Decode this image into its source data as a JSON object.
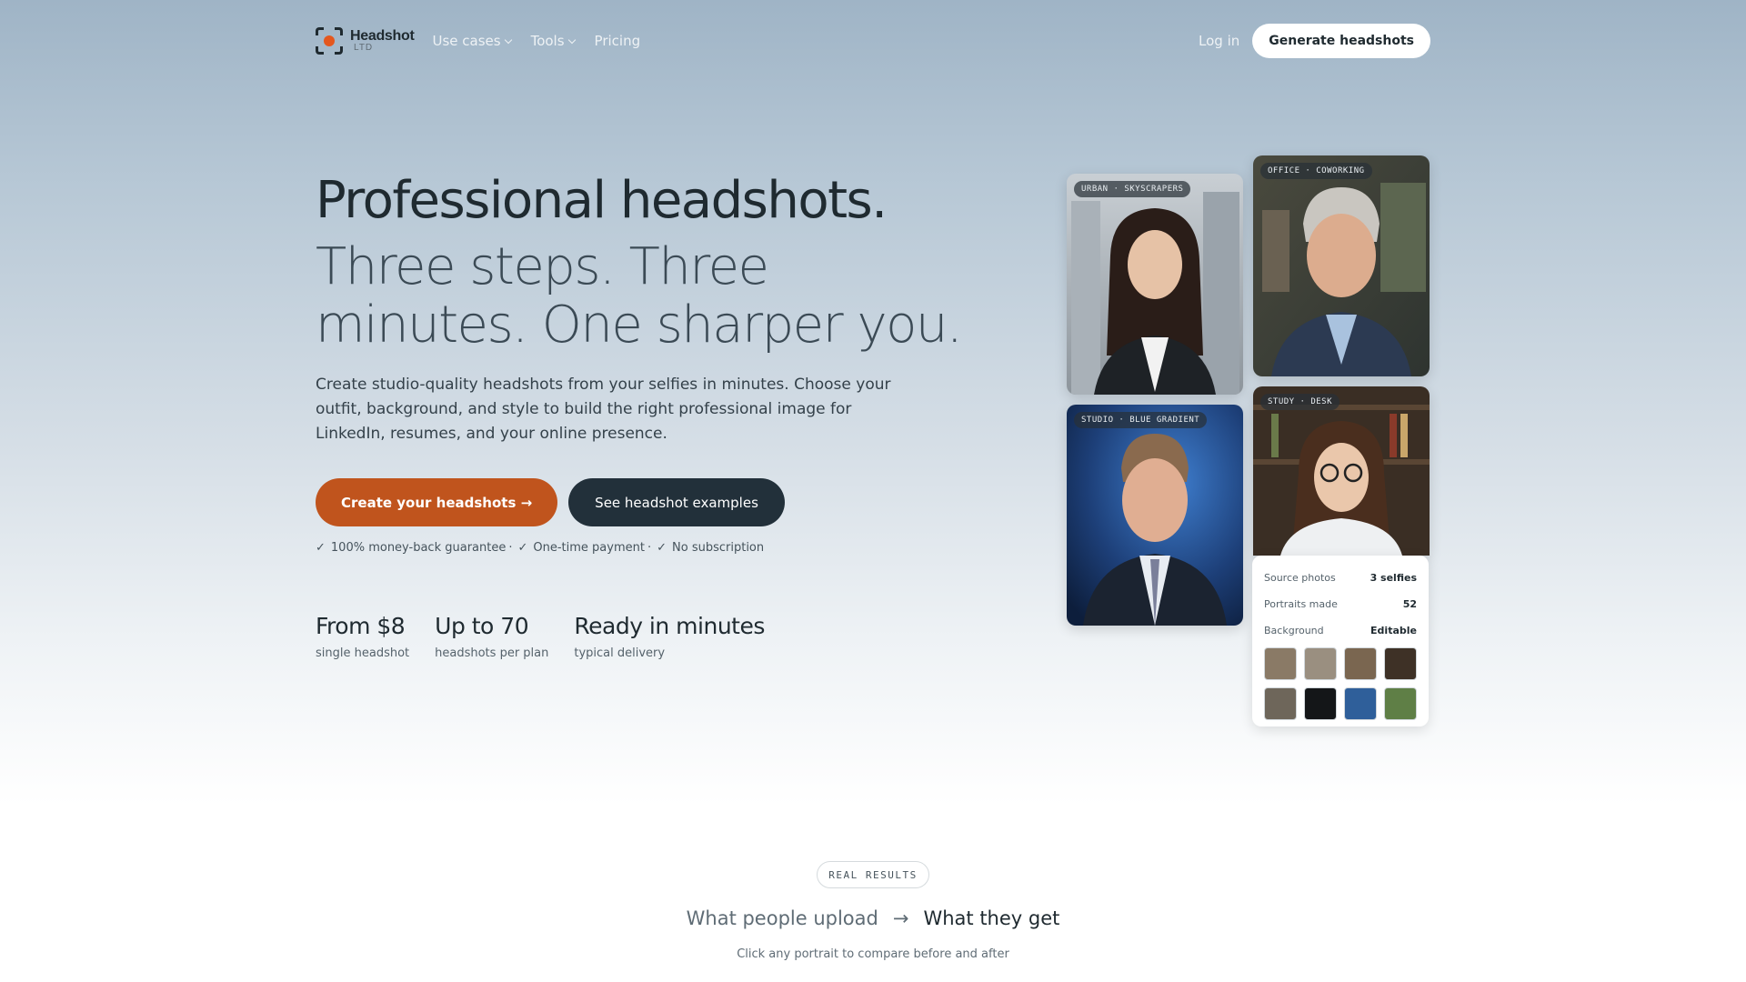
{
  "nav": {
    "logo_name": "Headshot",
    "logo_sub": "LTD",
    "menu": [
      {
        "label": "Use cases",
        "has_dropdown": true
      },
      {
        "label": "Tools",
        "has_dropdown": true
      },
      {
        "label": "Pricing",
        "has_dropdown": false
      }
    ],
    "login_label": "Log in",
    "cta_label": "Generate headshots"
  },
  "hero": {
    "title": "Professional headshots.",
    "subtitle": "Three steps. Three minutes. One sharper you.",
    "description": "Create studio-quality headshots from your selfies in minutes. Choose your outfit, background, and style to build the right professional image for LinkedIn, resumes, and your online presence.",
    "primary_cta": "Create your headshots →",
    "secondary_cta": "See headshot examples",
    "guarantees": [
      "100% money-back guarantee",
      "One-time payment",
      "No subscription"
    ],
    "stats": [
      {
        "value": "From $8",
        "label": "single headshot"
      },
      {
        "value": "Up to 70",
        "label": "headshots per plan"
      },
      {
        "value": "Ready in minutes",
        "label": "typical delivery"
      }
    ]
  },
  "photos": [
    {
      "tag": "URBAN · SKYSCRAPERS",
      "icon": "portrait-woman-urban"
    },
    {
      "tag": "OFFICE · COWORKING",
      "icon": "portrait-man-office"
    },
    {
      "tag": "STUDIO · BLUE GRADIENT",
      "icon": "portrait-man-studio"
    },
    {
      "tag": "STUDY · DESK",
      "icon": "portrait-woman-study"
    }
  ],
  "info_panel": {
    "rows": [
      {
        "key": "Source photos",
        "value": "3 selfies"
      },
      {
        "key": "Portraits made",
        "value": "52"
      },
      {
        "key": "Background",
        "value": "Editable"
      }
    ],
    "thumb_colors": [
      "#8a7a66",
      "#9a8f80",
      "#7a6650",
      "#3e3126",
      "#6e665a",
      "#141618",
      "#2f5f9a",
      "#5f7f46"
    ]
  },
  "results": {
    "pill": "REAL RESULTS",
    "upload_label": "What people upload",
    "arrow": "→",
    "get_label": "What they get",
    "hint": "Click any portrait to compare before and after"
  },
  "colors": {
    "accent": "#c0541d",
    "dark": "#22303a",
    "logo_dot": "#e4571e"
  }
}
